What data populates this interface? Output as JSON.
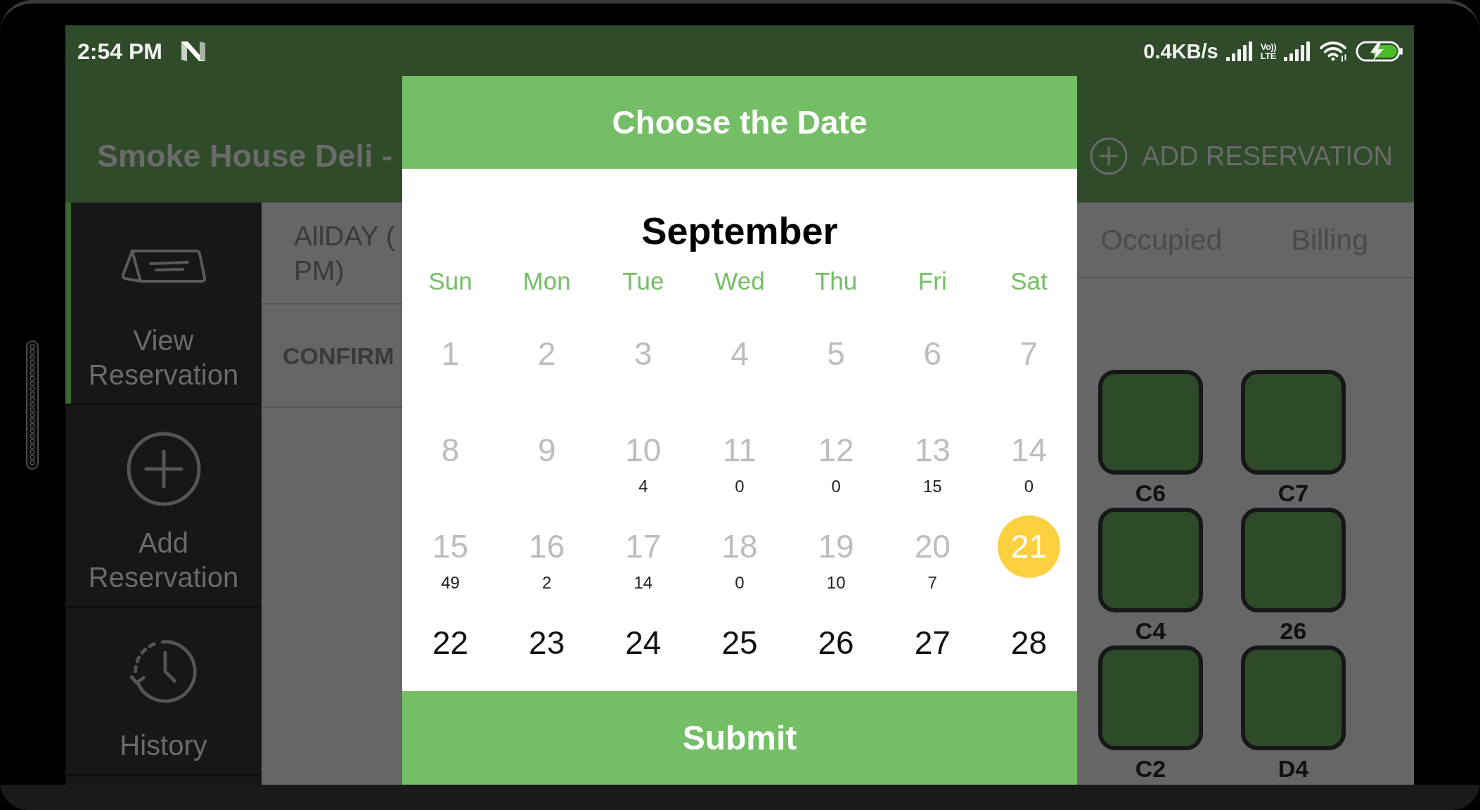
{
  "status_bar": {
    "time": "2:54 PM",
    "speed": "0.4KB/s",
    "network_badge": {
      "top": "Vo))",
      "bottom": "LTE"
    }
  },
  "toolbar": {
    "title": "Smoke House Deli -",
    "action": "ADD RESERVATION"
  },
  "sidebar": {
    "items": [
      {
        "label": "View Reservation",
        "selected": true
      },
      {
        "label": "Add Reservation",
        "selected": false
      },
      {
        "label": "History",
        "selected": false
      }
    ]
  },
  "reservation_list": {
    "shift_label": [
      "AllDAY (",
      "PM)"
    ],
    "status": "CONFIRM"
  },
  "floor_plan": {
    "tabs": [
      "Occupied",
      "Billing"
    ],
    "tables": [
      {
        "label": "C6"
      },
      {
        "label": "C7"
      },
      {
        "label": "C4"
      },
      {
        "label": "26"
      },
      {
        "label": "C2"
      },
      {
        "label": "D4"
      }
    ]
  },
  "date_dialog": {
    "title": "Choose the Date",
    "month": "September",
    "weekdays": [
      "Sun",
      "Mon",
      "Tue",
      "Wed",
      "Thu",
      "Fri",
      "Sat"
    ],
    "days": [
      {
        "day": "1",
        "disabled": true,
        "selected": false
      },
      {
        "day": "2",
        "disabled": true,
        "selected": false
      },
      {
        "day": "3",
        "disabled": true,
        "selected": false
      },
      {
        "day": "4",
        "disabled": true,
        "selected": false
      },
      {
        "day": "5",
        "disabled": true,
        "selected": false
      },
      {
        "day": "6",
        "disabled": true,
        "selected": false
      },
      {
        "day": "7",
        "disabled": true,
        "selected": false
      },
      {
        "day": "8",
        "disabled": true,
        "selected": false
      },
      {
        "day": "9",
        "disabled": true,
        "selected": false
      },
      {
        "day": "10",
        "count": "4",
        "disabled": true,
        "selected": false
      },
      {
        "day": "11",
        "count": "0",
        "disabled": true,
        "selected": false
      },
      {
        "day": "12",
        "count": "0",
        "disabled": true,
        "selected": false
      },
      {
        "day": "13",
        "count": "15",
        "disabled": true,
        "selected": false
      },
      {
        "day": "14",
        "count": "0",
        "disabled": true,
        "selected": false
      },
      {
        "day": "15",
        "count": "49",
        "disabled": true,
        "selected": false
      },
      {
        "day": "16",
        "count": "2",
        "disabled": true,
        "selected": false
      },
      {
        "day": "17",
        "count": "14",
        "disabled": true,
        "selected": false
      },
      {
        "day": "18",
        "count": "0",
        "disabled": true,
        "selected": false
      },
      {
        "day": "19",
        "count": "10",
        "disabled": true,
        "selected": false
      },
      {
        "day": "20",
        "count": "7",
        "disabled": true,
        "selected": false
      },
      {
        "day": "21",
        "disabled": false,
        "selected": true
      },
      {
        "day": "22",
        "disabled": false,
        "selected": false
      },
      {
        "day": "23",
        "disabled": false,
        "selected": false
      },
      {
        "day": "24",
        "disabled": false,
        "selected": false
      },
      {
        "day": "25",
        "disabled": false,
        "selected": false
      },
      {
        "day": "26",
        "disabled": false,
        "selected": false
      },
      {
        "day": "27",
        "disabled": false,
        "selected": false
      },
      {
        "day": "28",
        "disabled": false,
        "selected": false
      }
    ],
    "submit": "Submit"
  }
}
